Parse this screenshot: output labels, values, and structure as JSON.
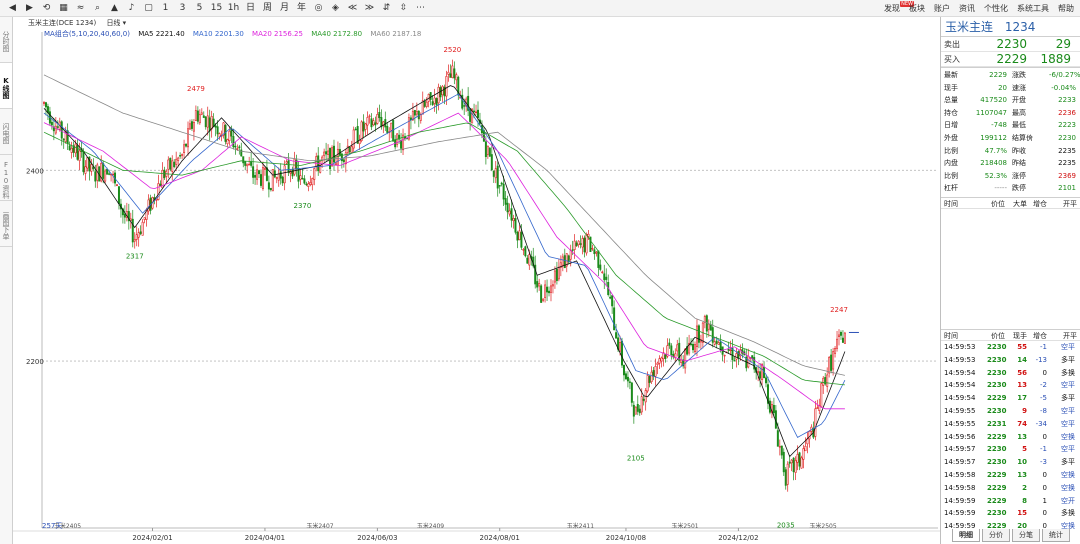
{
  "toolbar": {
    "items": [
      "◀",
      "▶",
      "⟲",
      "▦",
      "≈",
      "⌕",
      "▲",
      "♪",
      "▢",
      "1",
      "3",
      "5",
      "15",
      "1h",
      "日",
      "周",
      "月",
      "年",
      "◎",
      "◈",
      "≪",
      "≫",
      "⇵",
      "⇳",
      "⋯"
    ],
    "menus": [
      "发现",
      "板块",
      "账户",
      "资讯",
      "个性化",
      "系统工具",
      "帮助"
    ],
    "hot_badge": "NEW"
  },
  "left_tabs": [
    "分时图",
    "K线图",
    "闪电图",
    "F10资料",
    "画图下单"
  ],
  "chart_header": {
    "instrument": "玉米主连(DCE 1234)",
    "period": "日线"
  },
  "ma_legend": {
    "group": "MA组合(5,10,20,40,60,0)",
    "ma5": "MA5 2221.40",
    "ma10": "MA10 2201.30",
    "ma20": "MA20 2156.25",
    "ma40": "MA40 2172.80",
    "ma60": "MA60 2187.18"
  },
  "colors": {
    "up": "#e02020",
    "down": "#1a8a1a",
    "ma5": "#111111",
    "ma10": "#3366cc",
    "ma20": "#dd22dd",
    "ma40": "#2a9a2a",
    "ma60": "#888888"
  },
  "chart_data": {
    "type": "candlestick",
    "yticks": [
      2400,
      2200
    ],
    "ylim": [
      2025,
      2545
    ],
    "xlim": [
      0,
      440
    ],
    "date_ticks": [
      {
        "label": "2024/02/01",
        "x": 55
      },
      {
        "label": "2024/04/01",
        "x": 112
      },
      {
        "label": "2024/06/03",
        "x": 169
      },
      {
        "label": "2024/08/01",
        "x": 231
      },
      {
        "label": "2024/10/08",
        "x": 295
      },
      {
        "label": "2024/12/02",
        "x": 352
      }
    ],
    "contract_marks": [
      {
        "label": "玉米2405",
        "x": 5
      },
      {
        "label": "玉米2407",
        "x": 133
      },
      {
        "label": "玉米2409",
        "x": 189
      },
      {
        "label": "玉米2411",
        "x": 265
      },
      {
        "label": "玉米2501",
        "x": 318
      },
      {
        "label": "玉米2505",
        "x": 388
      }
    ],
    "left_label": "257天",
    "extreme_labels": [
      {
        "label": "2479",
        "x": 77,
        "y": 2479
      },
      {
        "label": "2520",
        "x": 207,
        "y": 2520
      },
      {
        "label": "2317",
        "x": 46,
        "y": 2317
      },
      {
        "label": "2370",
        "x": 131,
        "y": 2370
      },
      {
        "label": "2105",
        "x": 300,
        "y": 2105
      },
      {
        "label": "2035",
        "x": 376,
        "y": 2035
      },
      {
        "label": "2247",
        "x": 403,
        "y": 2247
      }
    ],
    "series": [
      {
        "name": "K",
        "anchors": [
          [
            0,
            2470
          ],
          [
            8,
            2440
          ],
          [
            16,
            2420
          ],
          [
            25,
            2395
          ],
          [
            33,
            2405
          ],
          [
            40,
            2355
          ],
          [
            46,
            2330
          ],
          [
            50,
            2345
          ],
          [
            60,
            2395
          ],
          [
            70,
            2415
          ],
          [
            77,
            2460
          ],
          [
            86,
            2450
          ],
          [
            96,
            2430
          ],
          [
            106,
            2395
          ],
          [
            116,
            2390
          ],
          [
            126,
            2405
          ],
          [
            131,
            2385
          ],
          [
            140,
            2410
          ],
          [
            150,
            2415
          ],
          [
            160,
            2440
          ],
          [
            170,
            2455
          ],
          [
            180,
            2430
          ],
          [
            190,
            2460
          ],
          [
            200,
            2480
          ],
          [
            207,
            2500
          ],
          [
            213,
            2470
          ],
          [
            220,
            2450
          ],
          [
            228,
            2400
          ],
          [
            236,
            2360
          ],
          [
            244,
            2315
          ],
          [
            252,
            2270
          ],
          [
            260,
            2295
          ],
          [
            268,
            2315
          ],
          [
            276,
            2325
          ],
          [
            283,
            2300
          ],
          [
            288,
            2250
          ],
          [
            294,
            2190
          ],
          [
            300,
            2145
          ],
          [
            306,
            2180
          ],
          [
            312,
            2205
          ],
          [
            318,
            2215
          ],
          [
            324,
            2200
          ],
          [
            330,
            2225
          ],
          [
            336,
            2240
          ],
          [
            342,
            2220
          ],
          [
            348,
            2210
          ],
          [
            356,
            2200
          ],
          [
            364,
            2190
          ],
          [
            370,
            2140
          ],
          [
            376,
            2080
          ],
          [
            383,
            2095
          ],
          [
            390,
            2130
          ],
          [
            396,
            2185
          ],
          [
            402,
            2215
          ],
          [
            406,
            2230
          ]
        ]
      },
      {
        "name": "MA5",
        "anchors": [
          [
            0,
            2465
          ],
          [
            20,
            2420
          ],
          [
            46,
            2340
          ],
          [
            70,
            2410
          ],
          [
            90,
            2455
          ],
          [
            116,
            2395
          ],
          [
            140,
            2405
          ],
          [
            170,
            2445
          ],
          [
            207,
            2490
          ],
          [
            225,
            2440
          ],
          [
            250,
            2290
          ],
          [
            270,
            2305
          ],
          [
            294,
            2200
          ],
          [
            305,
            2160
          ],
          [
            330,
            2225
          ],
          [
            360,
            2195
          ],
          [
            378,
            2100
          ],
          [
            390,
            2125
          ],
          [
            406,
            2210
          ]
        ]
      },
      {
        "name": "MA10",
        "anchors": [
          [
            0,
            2460
          ],
          [
            25,
            2420
          ],
          [
            50,
            2355
          ],
          [
            75,
            2410
          ],
          [
            95,
            2445
          ],
          [
            120,
            2400
          ],
          [
            145,
            2405
          ],
          [
            175,
            2440
          ],
          [
            210,
            2480
          ],
          [
            230,
            2420
          ],
          [
            255,
            2310
          ],
          [
            275,
            2300
          ],
          [
            300,
            2190
          ],
          [
            315,
            2180
          ],
          [
            340,
            2225
          ],
          [
            365,
            2190
          ],
          [
            382,
            2120
          ],
          [
            395,
            2135
          ],
          [
            406,
            2180
          ]
        ]
      },
      {
        "name": "MA20",
        "anchors": [
          [
            0,
            2450
          ],
          [
            30,
            2420
          ],
          [
            55,
            2380
          ],
          [
            80,
            2400
          ],
          [
            100,
            2435
          ],
          [
            125,
            2410
          ],
          [
            150,
            2405
          ],
          [
            180,
            2430
          ],
          [
            210,
            2460
          ],
          [
            235,
            2410
          ],
          [
            260,
            2330
          ],
          [
            285,
            2280
          ],
          [
            305,
            2215
          ],
          [
            325,
            2200
          ],
          [
            350,
            2215
          ],
          [
            375,
            2180
          ],
          [
            395,
            2150
          ],
          [
            406,
            2150
          ]
        ]
      },
      {
        "name": "MA40",
        "anchors": [
          [
            0,
            2440
          ],
          [
            40,
            2400
          ],
          [
            70,
            2395
          ],
          [
            100,
            2410
          ],
          [
            130,
            2405
          ],
          [
            160,
            2420
          ],
          [
            190,
            2440
          ],
          [
            215,
            2450
          ],
          [
            240,
            2420
          ],
          [
            265,
            2360
          ],
          [
            290,
            2290
          ],
          [
            315,
            2245
          ],
          [
            340,
            2225
          ],
          [
            365,
            2205
          ],
          [
            385,
            2180
          ],
          [
            406,
            2175
          ]
        ]
      },
      {
        "name": "MA60",
        "anchors": [
          [
            0,
            2500
          ],
          [
            40,
            2460
          ],
          [
            70,
            2440
          ],
          [
            100,
            2420
          ],
          [
            135,
            2410
          ],
          [
            165,
            2415
          ],
          [
            200,
            2430
          ],
          [
            230,
            2440
          ],
          [
            255,
            2400
          ],
          [
            280,
            2345
          ],
          [
            305,
            2290
          ],
          [
            330,
            2245
          ],
          [
            360,
            2220
          ],
          [
            385,
            2195
          ],
          [
            406,
            2185
          ]
        ]
      }
    ]
  },
  "panel": {
    "title_name": "玉米主连",
    "title_code": "1234",
    "ask": {
      "label": "卖出",
      "price": "2230",
      "vol": "29"
    },
    "bid": {
      "label": "买入",
      "price": "2229",
      "vol": "1889"
    },
    "stats": [
      {
        "k1": "最新",
        "v1": "2229",
        "c1": "green",
        "k2": "涨跌",
        "v2": "-6/0.27%",
        "c2": "green"
      },
      {
        "k1": "现手",
        "v1": "20",
        "c1": "green",
        "k2": "速涨",
        "v2": "-0.04%",
        "c2": "green"
      },
      {
        "k1": "总量",
        "v1": "417520",
        "c1": "green",
        "k2": "开盘",
        "v2": "2233",
        "c2": "green"
      },
      {
        "k1": "持仓",
        "v1": "1107047",
        "c1": "green",
        "k2": "最高",
        "v2": "2236",
        "c2": "red"
      },
      {
        "k1": "日增",
        "v1": "-748",
        "c1": "green",
        "k2": "最低",
        "v2": "2223",
        "c2": "green"
      },
      {
        "k1": "外盘",
        "v1": "199112",
        "c1": "green",
        "k2": "结算价",
        "v2": "2230",
        "c2": "green"
      },
      {
        "k1": "比例",
        "v1": "47.7%",
        "c1": "green",
        "k2": "昨收",
        "v2": "2235",
        "c2": "black"
      },
      {
        "k1": "内盘",
        "v1": "218408",
        "c1": "green",
        "k2": "昨结",
        "v2": "2235",
        "c2": "black"
      },
      {
        "k1": "比例",
        "v1": "52.3%",
        "c1": "green",
        "k2": "涨停",
        "v2": "2369",
        "c2": "red"
      },
      {
        "k1": "杠杆",
        "v1": "-----",
        "c1": "gray",
        "k2": "跌停",
        "v2": "2101",
        "c2": "green"
      }
    ],
    "table1_head": [
      "时间",
      "价位",
      "大单",
      "增仓",
      "开平"
    ],
    "table2_head": [
      "时间",
      "价位",
      "现手",
      "增仓",
      "开平"
    ],
    "ticks": [
      {
        "t": "14:59:53",
        "p": "2230",
        "v": "55",
        "vc": "red",
        "d": "-1",
        "n": "空平"
      },
      {
        "t": "14:59:53",
        "p": "2230",
        "v": "14",
        "vc": "green",
        "d": "-13",
        "n": "多平"
      },
      {
        "t": "14:59:54",
        "p": "2230",
        "v": "56",
        "vc": "red",
        "d": "0",
        "n": "多换"
      },
      {
        "t": "14:59:54",
        "p": "2230",
        "v": "13",
        "vc": "red",
        "d": "-2",
        "n": "空平"
      },
      {
        "t": "14:59:54",
        "p": "2229",
        "v": "17",
        "vc": "green",
        "d": "-5",
        "n": "多平"
      },
      {
        "t": "14:59:55",
        "p": "2230",
        "v": "9",
        "vc": "red",
        "d": "-8",
        "n": "空平"
      },
      {
        "t": "14:59:55",
        "p": "2231",
        "v": "74",
        "vc": "red",
        "d": "-34",
        "n": "空平"
      },
      {
        "t": "14:59:56",
        "p": "2229",
        "v": "13",
        "vc": "green",
        "d": "0",
        "n": "空换"
      },
      {
        "t": "14:59:57",
        "p": "2230",
        "v": "5",
        "vc": "red",
        "d": "-1",
        "n": "空平"
      },
      {
        "t": "14:59:57",
        "p": "2230",
        "v": "10",
        "vc": "green",
        "d": "-3",
        "n": "多平"
      },
      {
        "t": "14:59:58",
        "p": "2229",
        "v": "13",
        "vc": "green",
        "d": "0",
        "n": "空换"
      },
      {
        "t": "14:59:58",
        "p": "2229",
        "v": "2",
        "vc": "green",
        "d": "0",
        "n": "空换"
      },
      {
        "t": "14:59:59",
        "p": "2229",
        "v": "8",
        "vc": "green",
        "d": "1",
        "n": "空开"
      },
      {
        "t": "14:59:59",
        "p": "2230",
        "v": "15",
        "vc": "red",
        "d": "0",
        "n": "多换"
      },
      {
        "t": "14:59:59",
        "p": "2229",
        "v": "20",
        "vc": "green",
        "d": "0",
        "n": "空换"
      }
    ]
  },
  "bottom_tabs": [
    "明细",
    "分价",
    "分笔",
    "统计"
  ]
}
